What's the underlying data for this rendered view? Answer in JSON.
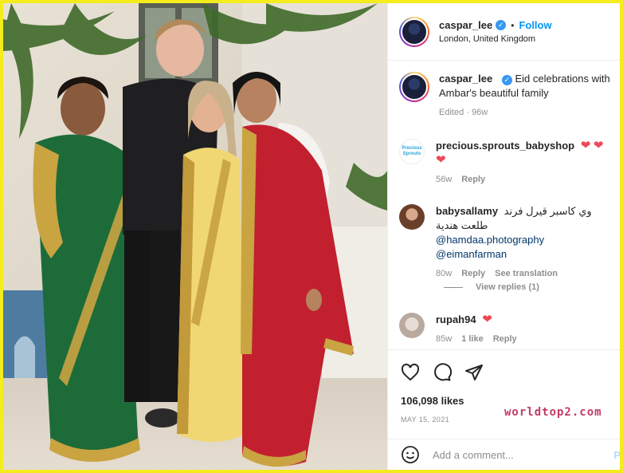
{
  "header": {
    "username": "caspar_lee",
    "separator": "•",
    "follow_label": "Follow",
    "location": "London, United Kingdom",
    "verified_icon": "verified-badge-icon"
  },
  "caption": {
    "username": "caspar_lee",
    "text": "Eid celebrations with Ambar's beautiful family",
    "edited": "Edited",
    "age": "96w"
  },
  "comments": [
    {
      "username": "precious.sprouts_babyshop",
      "text": "❤️ ❤️ ❤️",
      "age": "56w",
      "reply_label": "Reply",
      "avatar_text": "Precious Sprouts"
    },
    {
      "username": "babysallamy",
      "text": "وي كاسبر قيرل فرند طلعت هندية",
      "mention1": "@hamdaa.photography",
      "mention2": "@eimanfarman",
      "age": "80w",
      "reply_label": "Reply",
      "translate_label": "See translation"
    },
    {
      "username": "rupah94",
      "text": "❤️",
      "age": "85w",
      "likes": "1 like",
      "reply_label": "Reply"
    }
  ],
  "view_replies_label": "View replies (1)",
  "actions": {
    "like_icon": "heart-icon",
    "comment_icon": "comment-icon",
    "share_icon": "share-icon",
    "likes_text": "106,098 likes",
    "date": "MAY 15, 2021"
  },
  "watermark": "worldtop2.com",
  "add_comment": {
    "placeholder": "Add a comment...",
    "post_label": "P"
  },
  "colors": {
    "frame": "#f4ec1c",
    "link": "#0095f6",
    "heart": "#ed4956",
    "muted": "#8e8e8e"
  }
}
